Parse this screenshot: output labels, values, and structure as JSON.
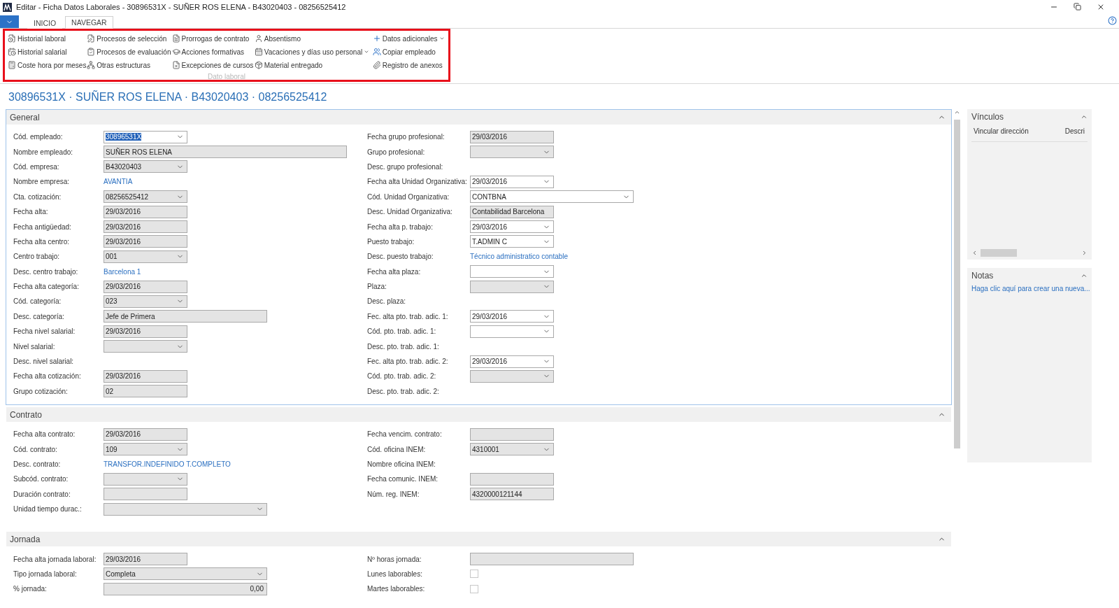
{
  "window": {
    "title": "Editar - Ficha Datos Laborales - 30896531X - SUÑER ROS ELENA - B43020403 - 08256525412"
  },
  "ribbon": {
    "tabs": [
      {
        "label": "INICIO",
        "selected": false
      },
      {
        "label": "NAVEGAR",
        "selected": true
      }
    ],
    "group": {
      "label": "Dato laboral",
      "columns": [
        [
          {
            "label": "Historial laboral"
          },
          {
            "label": "Historial salarial"
          },
          {
            "label": "Coste hora por meses"
          }
        ],
        [
          {
            "label": "Procesos de selección"
          },
          {
            "label": "Procesos de evaluación"
          },
          {
            "label": "Otras estructuras"
          }
        ],
        [
          {
            "label": "Prorrogas de contrato"
          },
          {
            "label": "Acciones formativas"
          },
          {
            "label": "Excepciones de cursos"
          }
        ],
        [
          {
            "label": "Absentismo"
          },
          {
            "label": "Vacaciones y días uso personal",
            "menu": true
          },
          {
            "label": "Material entregado"
          }
        ],
        [
          {
            "label": "Datos adicionales",
            "menu": true
          },
          {
            "label": "Copiar empleado"
          },
          {
            "label": "Registro de anexos"
          }
        ]
      ]
    }
  },
  "heading": "30896531X · SUÑER ROS ELENA · B43020403 · 08256525412",
  "sections": [
    {
      "title": "General",
      "focused": true,
      "columns": [
        [
          {
            "label": "Cód. empleado:",
            "kind": "dropdown",
            "value": "30896531X",
            "disabled": false,
            "text_selected": true
          },
          {
            "label": "Nombre empleado:",
            "kind": "text",
            "value": "SUÑER ROS ELENA",
            "disabled": true
          },
          {
            "label": "Cód. empresa:",
            "kind": "dropdown",
            "value": "B43020403",
            "disabled": true
          },
          {
            "label": "Nombre empresa:",
            "kind": "link",
            "value": "AVANTIA"
          },
          {
            "label": "Cta. cotización:",
            "kind": "dropdown",
            "value": "08256525412",
            "disabled": true
          },
          {
            "label": "Fecha alta:",
            "kind": "text",
            "value": "29/03/2016",
            "disabled": true
          },
          {
            "label": "Fecha antigüedad:",
            "kind": "text",
            "value": "29/03/2016",
            "disabled": true
          },
          {
            "label": "Fecha alta centro:",
            "kind": "text",
            "value": "29/03/2016",
            "disabled": true
          },
          {
            "label": "Centro trabajo:",
            "kind": "dropdown",
            "value": "001",
            "disabled": true
          },
          {
            "label": "Desc. centro trabajo:",
            "kind": "link",
            "value": "Barcelona 1"
          },
          {
            "label": "Fecha alta categoría:",
            "kind": "text",
            "value": "29/03/2016",
            "disabled": true
          },
          {
            "label": "Cód. categoría:",
            "kind": "dropdown",
            "value": "023",
            "disabled": true
          },
          {
            "label": "Desc. categoría:",
            "kind": "text",
            "value": "Jefe de Primera",
            "disabled": true
          },
          {
            "label": "Fecha nivel salarial:",
            "kind": "text",
            "value": "29/03/2016",
            "disabled": true
          },
          {
            "label": "Nivel salarial:",
            "kind": "dropdown",
            "disabled": true
          },
          {
            "label": "Desc. nivel salarial:",
            "kind": "label"
          },
          {
            "label": "Fecha alta cotización:",
            "kind": "text",
            "value": "29/03/2016",
            "disabled": true
          },
          {
            "label": "Grupo cotización:",
            "kind": "text",
            "value": "02",
            "disabled": true
          }
        ],
        [
          {
            "label": "Fecha grupo profesional:",
            "kind": "text",
            "value": "29/03/2016",
            "disabled": true
          },
          {
            "label": "Grupo profesional:",
            "kind": "dropdown",
            "disabled": true
          },
          {
            "label": "Desc. grupo profesional:",
            "kind": "label"
          },
          {
            "label": "Fecha alta Unidad Organizativa:",
            "kind": "dropdown",
            "value": "29/03/2016",
            "disabled": false
          },
          {
            "label": "Cód. Unidad Organizativa:",
            "kind": "dropdown",
            "value": "CONTBNA",
            "disabled": false
          },
          {
            "label": "Desc. Unidad Organizativa:",
            "kind": "text",
            "value": "Contabilidad Barcelona",
            "disabled": true
          },
          {
            "label": "Fecha alta p. trabajo:",
            "kind": "dropdown",
            "value": "29/03/2016",
            "disabled": false
          },
          {
            "label": "Puesto trabajo:",
            "kind": "dropdown",
            "value": "T.ADMIN C",
            "disabled": false
          },
          {
            "label": "Desc. puesto trabajo:",
            "kind": "link",
            "value": "Técnico administratico contable"
          },
          {
            "label": "Fecha alta plaza:",
            "kind": "dropdown",
            "disabled": false
          },
          {
            "label": "Plaza:",
            "kind": "dropdown",
            "disabled": true
          },
          {
            "label": "Desc. plaza:",
            "kind": "label"
          },
          {
            "label": "Fec. alta pto. trab. adic. 1:",
            "kind": "dropdown",
            "value": "29/03/2016",
            "disabled": false
          },
          {
            "label": "Cód. pto. trab. adic. 1:",
            "kind": "dropdown",
            "disabled": false
          },
          {
            "label": "Desc. pto. trab. adic. 1:",
            "kind": "label"
          },
          {
            "label": "Fec. alta pto. trab. adic. 2:",
            "kind": "dropdown",
            "value": "29/03/2016",
            "disabled": false
          },
          {
            "label": "Cód. pto. trab. adic. 2:",
            "kind": "dropdown",
            "disabled": true
          },
          {
            "label": "Desc. pto. trab. adic. 2:",
            "kind": "label"
          }
        ]
      ]
    },
    {
      "title": "Contrato",
      "focused": false,
      "columns": [
        [
          {
            "label": "Fecha alta contrato:",
            "kind": "text",
            "value": "29/03/2016",
            "disabled": true
          },
          {
            "label": "Cód. contrato:",
            "kind": "dropdown",
            "value": "109",
            "disabled": true
          },
          {
            "label": "Desc. contrato:",
            "kind": "link",
            "value": "TRANSFOR.INDEFINIDO T.COMPLETO"
          },
          {
            "label": "Subcód. contrato:",
            "kind": "dropdown",
            "disabled": true
          },
          {
            "label": "Duración contrato:",
            "kind": "text",
            "disabled": true
          },
          {
            "label": "Unidad tiempo durac.:",
            "kind": "dropdown",
            "disabled": true
          }
        ],
        [
          {
            "label": "Fecha vencim. contrato:",
            "kind": "text",
            "disabled": true
          },
          {
            "label": "Cód. oficina INEM:",
            "kind": "dropdown",
            "value": "4310001",
            "disabled": true
          },
          {
            "label": "Nombre oficina INEM:",
            "kind": "label"
          },
          {
            "label": "Fecha comunic. INEM:",
            "kind": "text",
            "disabled": true
          },
          {
            "label": "Núm. reg. INEM:",
            "kind": "text",
            "value": "4320000121144",
            "disabled": true
          }
        ]
      ]
    },
    {
      "title": "Jornada",
      "focused": false,
      "columns": [
        [
          {
            "label": "Fecha alta jornada laboral:",
            "kind": "text",
            "value": "29/03/2016",
            "disabled": true
          },
          {
            "label": "Tipo jornada laboral:",
            "kind": "dropdown",
            "value": "Completa",
            "disabled": true
          },
          {
            "label": "% jornada:",
            "kind": "text",
            "value": "0,00",
            "disabled": true
          }
        ],
        [
          {
            "label": "Nº horas jornada:",
            "kind": "text",
            "disabled": true
          },
          {
            "label": "Lunes laborables:",
            "kind": "checkbox",
            "checked": false
          },
          {
            "label": "Martes laborables:",
            "kind": "checkbox",
            "checked": false
          }
        ]
      ]
    }
  ],
  "factbox": {
    "links": {
      "title": "Vínculos",
      "columns": [
        "Vincular dirección",
        "Descri"
      ]
    },
    "notes": {
      "title": "Notas",
      "link": "Haga clic aquí para crear una nueva..."
    }
  }
}
